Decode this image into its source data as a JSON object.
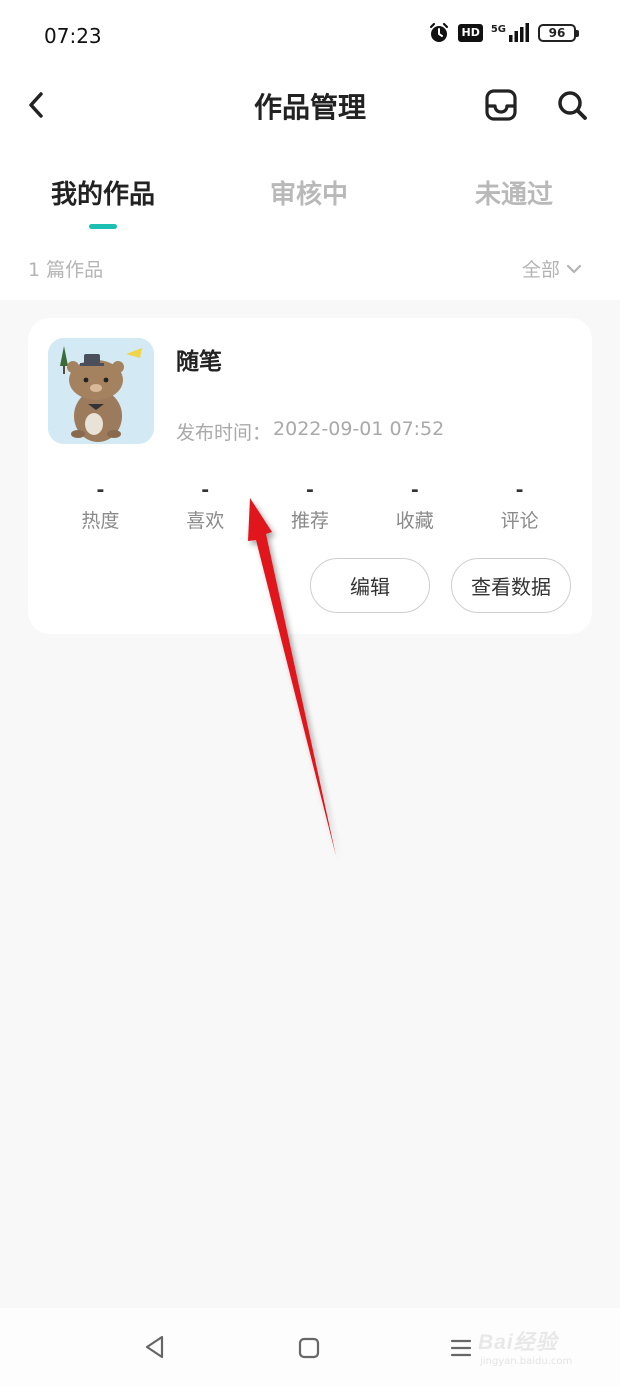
{
  "status_bar": {
    "time": "07:23",
    "icons": [
      "alarm-icon",
      "hd-icon",
      "5g-signal-icon",
      "battery-icon"
    ],
    "network": "5G",
    "hd": "HD",
    "battery": "96"
  },
  "header": {
    "title": "作品管理",
    "back_icon": "chevron-left-icon",
    "actions": [
      "inbox-icon",
      "search-icon"
    ]
  },
  "tabs": [
    {
      "label": "我的作品",
      "active": true
    },
    {
      "label": "审核中",
      "active": false
    },
    {
      "label": "未通过",
      "active": false
    }
  ],
  "list_header": {
    "count_label": "1 篇作品",
    "filter_label": "全部",
    "filter_icon": "chevron-down-icon"
  },
  "works": [
    {
      "title": "随笔",
      "publish_label": "发布时间：",
      "publish_time": "2022-09-01 07:52",
      "stats": [
        {
          "label": "热度",
          "value": "-"
        },
        {
          "label": "喜欢",
          "value": "-"
        },
        {
          "label": "推荐",
          "value": "-"
        },
        {
          "label": "收藏",
          "value": "-"
        },
        {
          "label": "评论",
          "value": "-"
        }
      ],
      "buttons": {
        "edit": "编辑",
        "view_data": "查看数据"
      }
    }
  ],
  "nav_bar": {
    "icons": [
      "nav-back-icon",
      "nav-home-icon",
      "nav-menu-icon"
    ]
  },
  "watermark": {
    "brand": "Bai经验",
    "url": "jingyan.baidu.com"
  },
  "colors": {
    "accent": "#1cbfb1",
    "annotation_arrow": "#e0161b",
    "background": "#f8f8f8"
  }
}
